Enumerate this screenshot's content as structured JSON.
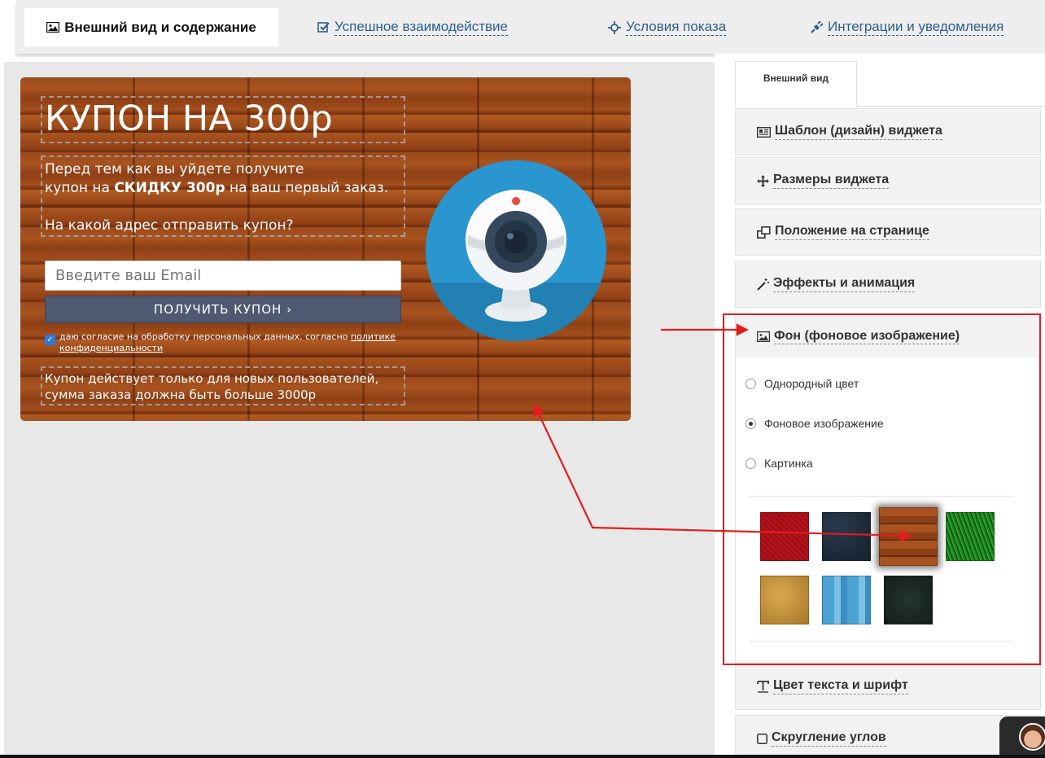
{
  "topnav": {
    "tabs": [
      {
        "label": "Внешний вид и содержание",
        "icon": "image-icon",
        "active": true
      },
      {
        "label": "Успешное взаимодействие",
        "icon": "check-square-icon"
      },
      {
        "label": "Условия показа",
        "icon": "crosshair-icon"
      },
      {
        "label": "Интеграции и уведомления",
        "icon": "plug-icon"
      }
    ]
  },
  "widget": {
    "title": "КУПОН НА 300р",
    "text_line1": "Перед тем как вы уйдете получите",
    "text_line2_pre": "купон на ",
    "text_line2_bold": "СКИДКУ 300р",
    "text_line2_post": " на ваш первый заказ.",
    "question": "На какой адрес отправить купон?",
    "email_placeholder": "Введите ваш Email",
    "button_label": "ПОЛУЧИТЬ КУПОН ›",
    "consent_text": "даю согласие на обработку персональных данных, согласно ",
    "consent_link": "политике конфиденциальности",
    "footer_note": "Купон действует только для новых пользователей, сумма заказа должна быть больше 3000р",
    "image_icon": "webcam-icon"
  },
  "right_panel": {
    "tab_label": "Внешний вид",
    "sections": [
      {
        "label": "Шаблон (дизайн) виджета",
        "icon": "template-icon"
      },
      {
        "label": "Размеры виджета",
        "icon": "move-icon"
      },
      {
        "label": "Положение на странице",
        "icon": "position-icon"
      },
      {
        "label": "Эффекты и анимация",
        "icon": "magic-wand-icon"
      },
      {
        "label": "Фон (фоновое изображение)",
        "icon": "image-icon",
        "expanded": true
      },
      {
        "label": "Цвет текста и шрифт",
        "icon": "text-icon"
      },
      {
        "label": "Скругление углов",
        "icon": "square-icon"
      }
    ],
    "background_options": [
      {
        "label": "Однородный цвет",
        "selected": false
      },
      {
        "label": "Фоновое изображение",
        "selected": true
      },
      {
        "label": "Картинка",
        "selected": false
      }
    ],
    "swatches": [
      {
        "name": "red-fabric",
        "color": "#b3121a",
        "selected": false
      },
      {
        "name": "dark-navy",
        "color": "#1e2a3a",
        "selected": false
      },
      {
        "name": "wood",
        "color": "#9c4a1c",
        "selected": true
      },
      {
        "name": "green-grass",
        "color": "#1f8a1f",
        "selected": false
      },
      {
        "name": "sand-cork",
        "color": "#c8963e",
        "selected": false
      },
      {
        "name": "blue-chevron",
        "color": "#4aa3d4",
        "selected": false
      },
      {
        "name": "dark-green-pattern",
        "color": "#1c2a24",
        "selected": false
      }
    ]
  },
  "colors": {
    "link": "#2d5e8c",
    "annotation_red": "#e21d1d",
    "button_bg": "#4f5a72"
  }
}
